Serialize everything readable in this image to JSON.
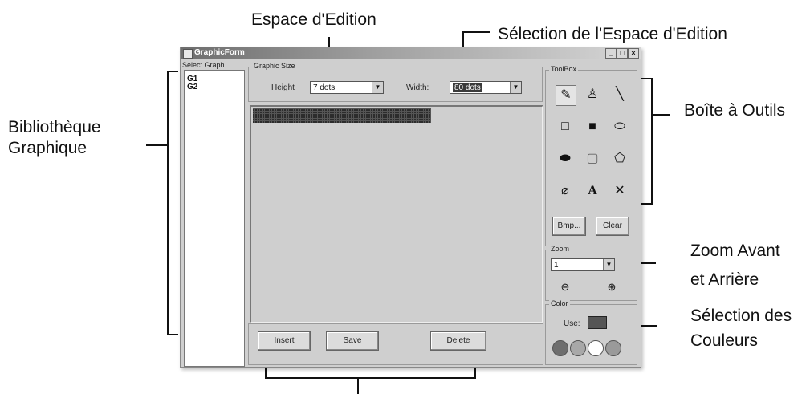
{
  "annotations": {
    "edit_space": "Espace d'Edition",
    "edit_space_selection": "Sélection de l'Espace d'Edition",
    "library_line1": "Bibliothèque",
    "library_line2": "Graphique",
    "toolbox_label": "Boîte à Outils",
    "zoom_line1": "Zoom Avant",
    "zoom_line2": "et Arrière",
    "colors_line1": "Sélection des",
    "colors_line2": "Couleurs"
  },
  "window": {
    "title": "GraphicForm",
    "minimize": "_",
    "maximize": "□",
    "close": "×"
  },
  "select_graph": {
    "label": "Select Graph",
    "items": [
      "G1",
      "G2"
    ]
  },
  "graphic_size": {
    "label": "Graphic Size",
    "height_label": "Height",
    "height_value": "7 dots",
    "width_label": "Width:",
    "width_value": "80 dots"
  },
  "buttons": {
    "insert": "Insert",
    "save": "Save",
    "delete": "Delete"
  },
  "toolbox": {
    "label": "ToolBox",
    "bmp": "Bmp...",
    "clear": "Clear",
    "tools": [
      "pencil-icon",
      "fill-bucket-icon",
      "line-icon",
      "rectangle-outline-icon",
      "rectangle-filled-icon",
      "ellipse-outline-icon",
      "ellipse-filled-icon",
      "rounded-rect-icon",
      "freeform-icon",
      "eraser-icon",
      "text-icon",
      "clear-x-icon"
    ]
  },
  "zoom": {
    "label": "Zoom",
    "value": "1"
  },
  "color": {
    "label": "Color",
    "use_label": "Use:",
    "current": "#555555",
    "palette": [
      "#6e6e6e",
      "#a8a8a8",
      "#ffffff",
      "#9a9a9a"
    ]
  }
}
